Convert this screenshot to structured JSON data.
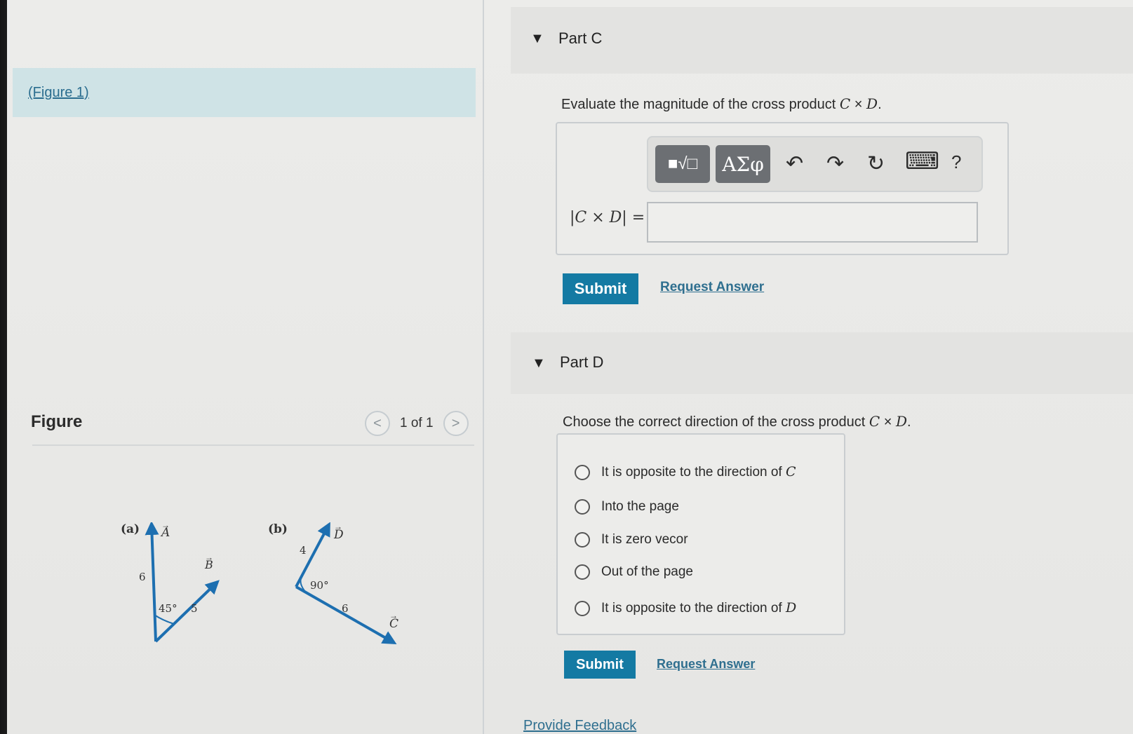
{
  "left": {
    "figure_link": "(Figure 1)",
    "figure_title": "Figure",
    "pager": {
      "prev": "<",
      "count": "1 of 1",
      "next": ">"
    },
    "figure": {
      "a": {
        "panel_label": "(a)",
        "vec_a": "A",
        "vec_b": "B",
        "len_a": "6",
        "len_b": "5",
        "angle": "45°"
      },
      "b": {
        "panel_label": "(b)",
        "vec_d": "D",
        "vec_c": "C",
        "len_d": "4",
        "len_c": "6",
        "angle": "90°"
      }
    }
  },
  "part_c": {
    "caret": "▼",
    "title": "Part C",
    "prompt_text": "Evaluate the magnitude of the cross product ",
    "prompt_vec1": "C",
    "prompt_times": " × ",
    "prompt_vec2": "D",
    "prompt_end": ".",
    "toolbar": {
      "templates_icon": "templates-icon",
      "greek_label": "ΑΣφ",
      "undo_icon": "↶",
      "redo_icon": "↷",
      "reset_icon": "↻",
      "keyboard_icon": "⌨",
      "help_icon": "?"
    },
    "expr_label": "|C × D| =",
    "input_value": "",
    "submit": "Submit",
    "request": "Request Answer"
  },
  "part_d": {
    "caret": "▼",
    "title": "Part D",
    "prompt_text": "Choose the correct direction of the cross product ",
    "prompt_vec1": "C",
    "prompt_times": " × ",
    "prompt_vec2": "D",
    "prompt_end": ".",
    "options": [
      {
        "label": "It is opposite to the direction of ",
        "vec": "C"
      },
      {
        "label": "Into the page",
        "vec": ""
      },
      {
        "label": "It is zero vecor",
        "vec": ""
      },
      {
        "label": "Out of the page",
        "vec": ""
      },
      {
        "label": "It is opposite to the direction of ",
        "vec": "D"
      }
    ],
    "submit": "Submit",
    "request": "Request Answer"
  },
  "feedback": "Provide Feedback",
  "colors": {
    "accent": "#147aa3",
    "link": "#2f6f8f",
    "vector": "#1d6fb0"
  }
}
